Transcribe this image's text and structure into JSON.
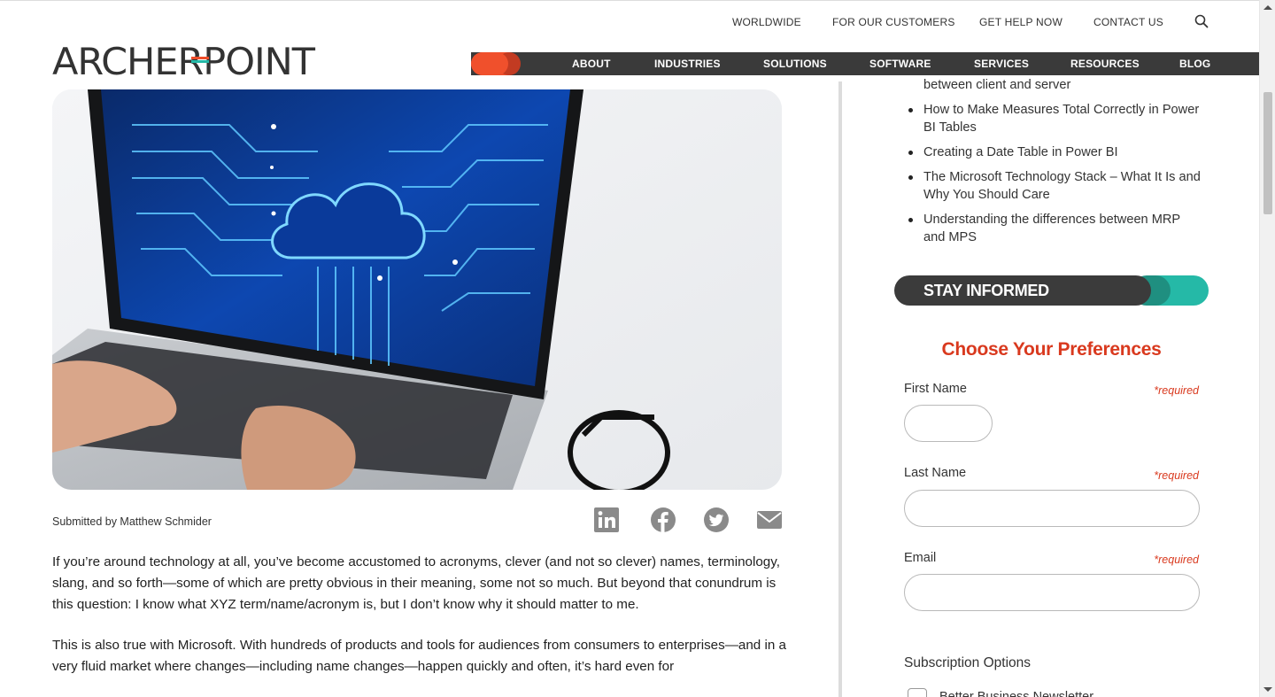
{
  "utility_nav": {
    "worldwide": "WORLDWIDE",
    "customers": "FOR OUR CUSTOMERS",
    "help": "GET HELP NOW",
    "contact": "CONTACT US"
  },
  "logo": {
    "text": "ARCHERPOINT"
  },
  "main_nav": {
    "items": [
      "ABOUT",
      "INDUSTRIES",
      "SOLUTIONS",
      "SOFTWARE",
      "SERVICES",
      "RESOURCES",
      "BLOG"
    ]
  },
  "article": {
    "submitted_by": "Submitted by Matthew Schmider",
    "paragraphs": [
      "If you’re around technology at all, you’ve become accustomed to acronyms, clever (and not so clever) names, terminology, slang, and so forth—some of which are pretty obvious in their meaning, some not so much. But beyond that conundrum is this question: I know what XYZ term/name/acronym is, but I don’t know why it should matter to me.",
      "This is also true with Microsoft. With hundreds of products and tools for audiences from consumers to enterprises—and in a very fluid market where changes—including name changes—happen quickly and often, it’s hard even for"
    ],
    "share_icons": [
      "linkedin-icon",
      "facebook-icon",
      "twitter-icon",
      "email-icon"
    ]
  },
  "sidebar": {
    "cont_text": "between client and server",
    "related_posts": [
      "How to Make Measures Total Correctly in Power BI Tables",
      "Creating a Date Table in Power BI",
      "The Microsoft Technology Stack – What It Is and Why You Should Care",
      "Understanding the differences between MRP and MPS"
    ],
    "stay_informed": "STAY INFORMED",
    "prefs_title": "Choose Your Preferences",
    "form": {
      "first_name_label": "First Name",
      "last_name_label": "Last Name",
      "email_label": "Email",
      "required": "*required",
      "first_name_value": "",
      "last_name_value": "",
      "email_value": ""
    },
    "subscription_options": "Subscription Options",
    "checkbox_label": "Better Business Newsletter"
  },
  "colors": {
    "brand_red": "#ef4d2a",
    "nav_dark": "#3a3a3a",
    "teal": "#25b9a7",
    "accent_red_text": "#d9391e"
  }
}
